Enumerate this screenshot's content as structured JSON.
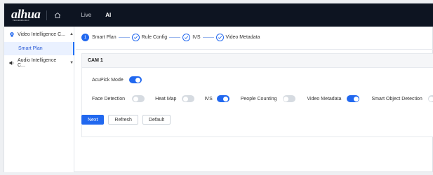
{
  "brand": {
    "logo": "alhua",
    "logo_sub": "TECHNOLOGY"
  },
  "nav": {
    "items": [
      "Live",
      "AI"
    ],
    "active": "AI"
  },
  "sidebar": {
    "groups": [
      {
        "label": "Video Intelligence C...",
        "expanded": true,
        "sub_items": [
          "Smart Plan"
        ]
      },
      {
        "label": "Audio Intelligence C...",
        "expanded": false
      }
    ]
  },
  "steps": [
    {
      "num": "1",
      "label": "Smart Plan",
      "state": "current"
    },
    {
      "label": "Rule Config",
      "state": "done"
    },
    {
      "label": "IVS",
      "state": "done"
    },
    {
      "label": "Video Metadata",
      "state": "done"
    }
  ],
  "card": {
    "title": "CAM 1",
    "acupick": {
      "label": "AcuPick Mode",
      "on": true
    },
    "features": [
      {
        "label": "Face Detection",
        "on": false
      },
      {
        "label": "Heat Map",
        "on": false
      },
      {
        "label": "IVS",
        "on": true
      },
      {
        "label": "People Counting",
        "on": false
      },
      {
        "label": "Video Metadata",
        "on": true
      },
      {
        "label": "Smart Object Detection",
        "on": false
      }
    ]
  },
  "buttons": {
    "next": "Next",
    "refresh": "Refresh",
    "default": "Default"
  },
  "colors": {
    "accent": "#2168ef",
    "topbar": "#0d1421"
  }
}
